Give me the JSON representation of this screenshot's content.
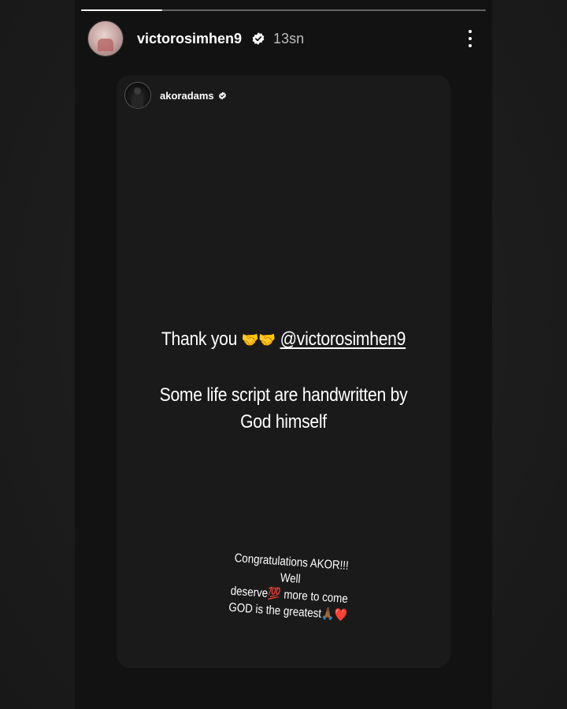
{
  "story": {
    "progress_fraction": 0.2,
    "author": {
      "username": "victorosimhen9",
      "time_ago": "13sn",
      "verified": true
    }
  },
  "shared_post": {
    "username": "akoradams",
    "verified": true,
    "thank_text": "Thank you",
    "handshake_emoji": "🤝🤝",
    "mention": "@victorosimhen9",
    "caption": "Some life script are handwritten by God himself",
    "congrats_line1": "Congratulations AKOR!!! Well",
    "congrats_line2a": "deserve",
    "congrats_emoji_100": "💯",
    "congrats_line2b": " more to come",
    "congrats_line3": "GOD is the greatest",
    "congrats_emoji_end": "🙏🏾❤️"
  },
  "icons": {
    "verified": "verified-badge-icon",
    "more": "more-options-icon"
  },
  "colors": {
    "background": "#1e1e1e",
    "story_bg": "#121212",
    "card_bg": "#1a1a1a",
    "text": "#ffffff",
    "muted": "#bdbdbd"
  }
}
